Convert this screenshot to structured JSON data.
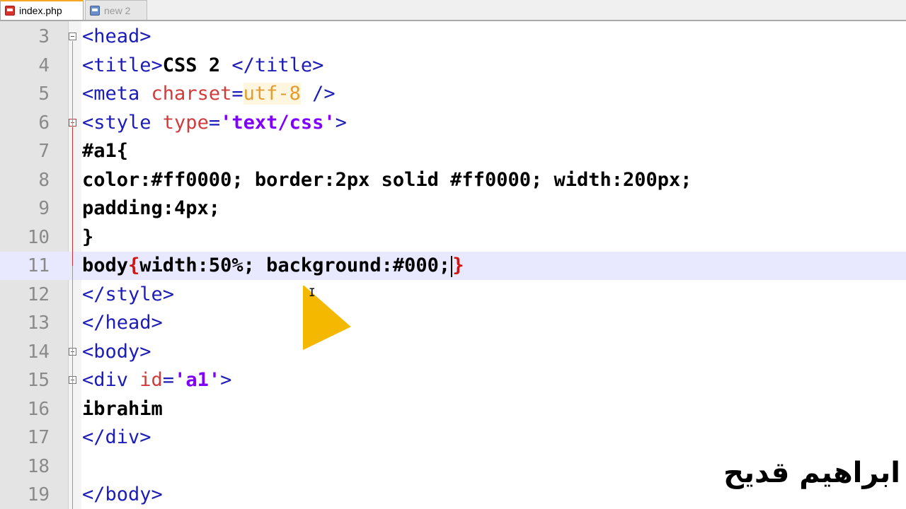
{
  "tabs": [
    {
      "label": "index.php",
      "active": true,
      "icon": "php-file-icon"
    },
    {
      "label": "new 2",
      "active": false,
      "icon": "text-file-icon"
    }
  ],
  "lines": [
    {
      "num": "3",
      "fold": "box",
      "tokens": [
        {
          "t": "tag",
          "s": "<head>"
        }
      ]
    },
    {
      "num": "4",
      "tokens": [
        {
          "t": "tag",
          "s": "<title>"
        },
        {
          "t": "text",
          "s": "CSS 2 "
        },
        {
          "t": "tag",
          "s": "</title>"
        }
      ]
    },
    {
      "num": "5",
      "tokens": [
        {
          "t": "tag",
          "s": "<meta "
        },
        {
          "t": "attr",
          "s": "charset"
        },
        {
          "t": "tag",
          "s": "="
        },
        {
          "t": "valplain",
          "s": "utf-8"
        },
        {
          "t": "tag",
          "s": " />"
        }
      ]
    },
    {
      "num": "6",
      "fold": "box-red",
      "tokens": [
        {
          "t": "tag",
          "s": "<style "
        },
        {
          "t": "attr",
          "s": "type"
        },
        {
          "t": "tag",
          "s": "="
        },
        {
          "t": "val",
          "s": "'text/css'"
        },
        {
          "t": "tag",
          "s": ">"
        }
      ]
    },
    {
      "num": "7",
      "tokens": [
        {
          "t": "text",
          "s": "#a1{"
        }
      ]
    },
    {
      "num": "8",
      "tokens": [
        {
          "t": "text",
          "s": "color:#ff0000; border:2px solid #ff0000; width:200px;"
        }
      ]
    },
    {
      "num": "9",
      "tokens": [
        {
          "t": "text",
          "s": "padding:4px;"
        }
      ]
    },
    {
      "num": "10",
      "tokens": [
        {
          "t": "text",
          "s": "}"
        }
      ]
    },
    {
      "num": "11",
      "current": true,
      "tokens": [
        {
          "t": "text",
          "s": "body"
        },
        {
          "t": "brace",
          "s": "{"
        },
        {
          "t": "text",
          "s": "width:50%; background:#000;"
        },
        {
          "t": "caret",
          "s": ""
        },
        {
          "t": "brace",
          "s": "}"
        }
      ]
    },
    {
      "num": "12",
      "tokens": [
        {
          "t": "tag",
          "s": "</style>"
        }
      ]
    },
    {
      "num": "13",
      "tokens": [
        {
          "t": "tag",
          "s": "</head>"
        }
      ]
    },
    {
      "num": "14",
      "fold": "box",
      "tokens": [
        {
          "t": "tag",
          "s": "<body>"
        }
      ]
    },
    {
      "num": "15",
      "fold": "box",
      "tokens": [
        {
          "t": "tag",
          "s": "<div "
        },
        {
          "t": "attr",
          "s": "id"
        },
        {
          "t": "tag",
          "s": "="
        },
        {
          "t": "val",
          "s": "'a1'"
        },
        {
          "t": "tag",
          "s": ">"
        }
      ]
    },
    {
      "num": "16",
      "tokens": [
        {
          "t": "text",
          "s": "ibrahim"
        }
      ]
    },
    {
      "num": "17",
      "tokens": [
        {
          "t": "tag",
          "s": "</div>"
        }
      ]
    },
    {
      "num": "18",
      "tokens": []
    },
    {
      "num": "19",
      "tokens": [
        {
          "t": "tag",
          "s": "</body>"
        }
      ]
    }
  ],
  "watermark": "ابراهيم قديح",
  "colors": {
    "tag": "#1c1cb8",
    "attr": "#d03b3b",
    "value": "#8000ff",
    "current_line": "#e8e8ff",
    "cursor": "#f5b800"
  }
}
